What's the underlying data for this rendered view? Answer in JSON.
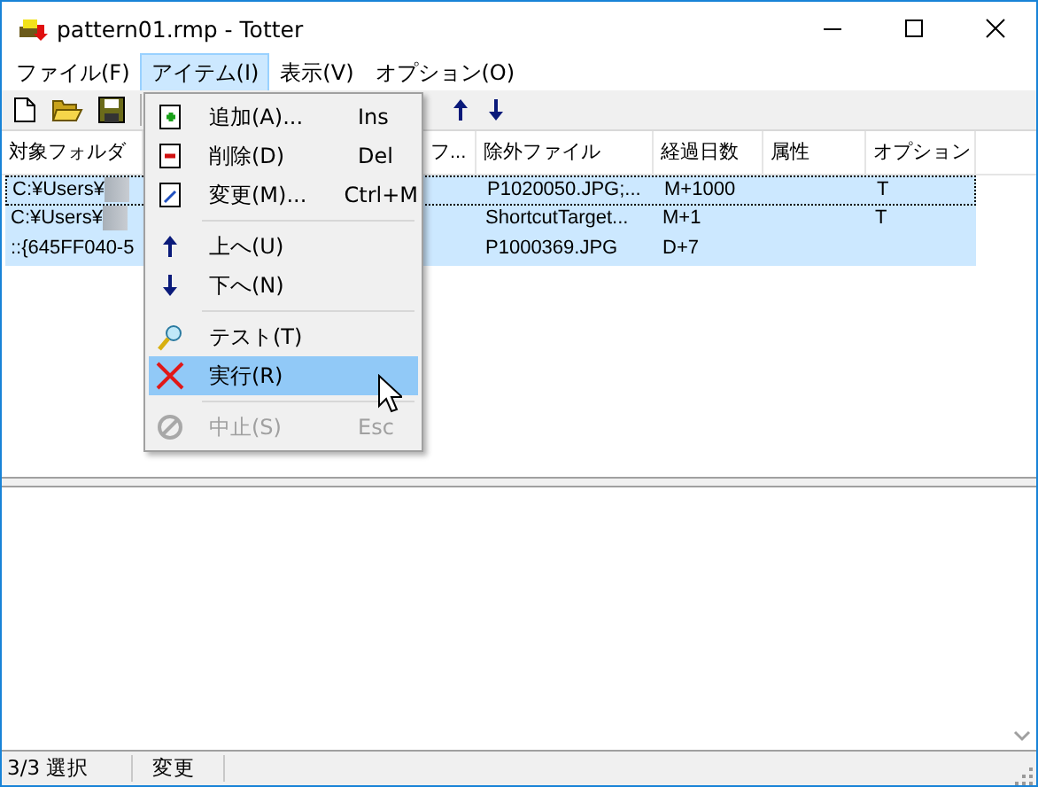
{
  "window": {
    "title": "pattern01.rmp - Totter"
  },
  "menubar": [
    {
      "label": "ファイル(F)",
      "selected": false
    },
    {
      "label": "アイテム(I)",
      "selected": true
    },
    {
      "label": "表示(V)",
      "selected": false
    },
    {
      "label": "オプション(O)",
      "selected": false
    }
  ],
  "list": {
    "columns": [
      {
        "label": "対象フォルダ"
      },
      {
        "label": "フ..."
      },
      {
        "label": "除外ファイル"
      },
      {
        "label": "経過日数"
      },
      {
        "label": "属性"
      },
      {
        "label": "オプション"
      }
    ],
    "rows": [
      {
        "selected": true,
        "focused": true,
        "cells": [
          {
            "text": "C:¥Users¥",
            "redacted": true
          },
          null,
          {
            "text": "P1020050.JPG;..."
          },
          {
            "text": "M+1000"
          },
          null,
          {
            "text": "T"
          }
        ]
      },
      {
        "selected": true,
        "focused": false,
        "cells": [
          {
            "text": "C:¥Users¥",
            "redacted": true
          },
          null,
          {
            "text": "ShortcutTarget..."
          },
          {
            "text": "M+1"
          },
          null,
          {
            "text": "T"
          }
        ]
      },
      {
        "selected": true,
        "focused": false,
        "cells": [
          {
            "text": "::{645FF040-5",
            "redacted": false
          },
          null,
          {
            "text": "P1000369.JPG"
          },
          {
            "text": "D+7"
          },
          null,
          null
        ]
      }
    ]
  },
  "dropdown_menu": {
    "items": [
      {
        "kind": "item",
        "label": "追加(A)...",
        "shortcut": "Ins",
        "disabled": false,
        "selected": false
      },
      {
        "kind": "item",
        "label": "削除(D)",
        "shortcut": "Del",
        "disabled": false,
        "selected": false
      },
      {
        "kind": "item",
        "label": "変更(M)...",
        "shortcut": "Ctrl+M",
        "disabled": false,
        "selected": false
      },
      {
        "kind": "separator"
      },
      {
        "kind": "item",
        "label": "上へ(U)",
        "disabled": false,
        "selected": false
      },
      {
        "kind": "item",
        "label": "下へ(N)",
        "disabled": false,
        "selected": false
      },
      {
        "kind": "separator"
      },
      {
        "kind": "item",
        "label": "テスト(T)",
        "disabled": false,
        "selected": false
      },
      {
        "kind": "item",
        "label": "実行(R)",
        "disabled": false,
        "selected": true
      },
      {
        "kind": "separator"
      },
      {
        "kind": "item",
        "label": "中止(S)",
        "shortcut": "Esc",
        "disabled": true,
        "selected": false
      }
    ]
  },
  "status_bar": [
    "3/3 選択",
    "変更"
  ]
}
